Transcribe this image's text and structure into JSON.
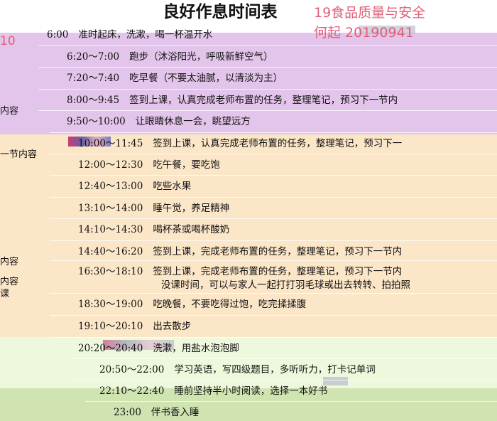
{
  "title": "良好作息时间表",
  "overlay": {
    "line1": "19食品质量与安全",
    "line2": "何起     20190941",
    "line3": "10"
  },
  "colors": {
    "purple": "#e3c4ea",
    "orange": "#fce6c8",
    "light_green": "#eef8dc",
    "green": "#cfe4b0",
    "overlay_text": "#e0607a"
  },
  "left_fragments": [
    "内容",
    "一节内容",
    "内容",
    "内容",
    "课"
  ],
  "schedule": [
    {
      "time": "6:00",
      "activity": "准时起床，洗漱，喝一杯温开水"
    },
    {
      "time": "6:20～7:00",
      "activity": "跑步（沐浴阳光，呼吸新鲜空气）"
    },
    {
      "time": "7:20～7:40",
      "activity": "吃早餐（不要太油腻，以清淡为主）"
    },
    {
      "time": "8:00～9:45",
      "activity": "签到上课，认真完成老师布置的任务，整理笔记，预习下一节内"
    },
    {
      "time": "9:50～10:00",
      "activity": "让眼睛休息一会，眺望远方"
    },
    {
      "time": "10:00～11:45",
      "activity": "签到上课，认真完成老师布置的任务，整理笔记，预习下一"
    },
    {
      "time": "12:00～12:30",
      "activity": "吃午餐，要吃饱"
    },
    {
      "time": "12:40～13:00",
      "activity": "吃些水果"
    },
    {
      "time": "13:10～14:00",
      "activity": "睡午觉，养足精神"
    },
    {
      "time": "14:10～14:30",
      "activity": "喝杯茶或喝杯酸奶"
    },
    {
      "time": "14:40～16:20",
      "activity": "签到上课，完成老师布置的任务，整理笔记，预习下一节内"
    },
    {
      "time": "16:30～18:10",
      "activity": "签到上课，完成老师布置的任务，整理笔记，预习下一节内",
      "activity2": "没课时间，可以与家人一起打打羽毛球或出去转转、拍拍照"
    },
    {
      "time": "18:30～19:00",
      "activity": "吃晚餐，不要吃得过饱，吃完揉揉腹"
    },
    {
      "time": "19:10～20:10",
      "activity": "出去散步"
    },
    {
      "time": "20:20～20:40",
      "activity": "洗漱，用盐水泡泡脚"
    },
    {
      "time": "20:50～22:00",
      "activity": "学习英语，写四级题目，多听听力，打卡记单词"
    },
    {
      "time": "22:10～22:40",
      "activity": "睡前坚持半小时阅读，选择一本好书"
    },
    {
      "time": "23:00",
      "activity": "伴书香入睡"
    }
  ]
}
